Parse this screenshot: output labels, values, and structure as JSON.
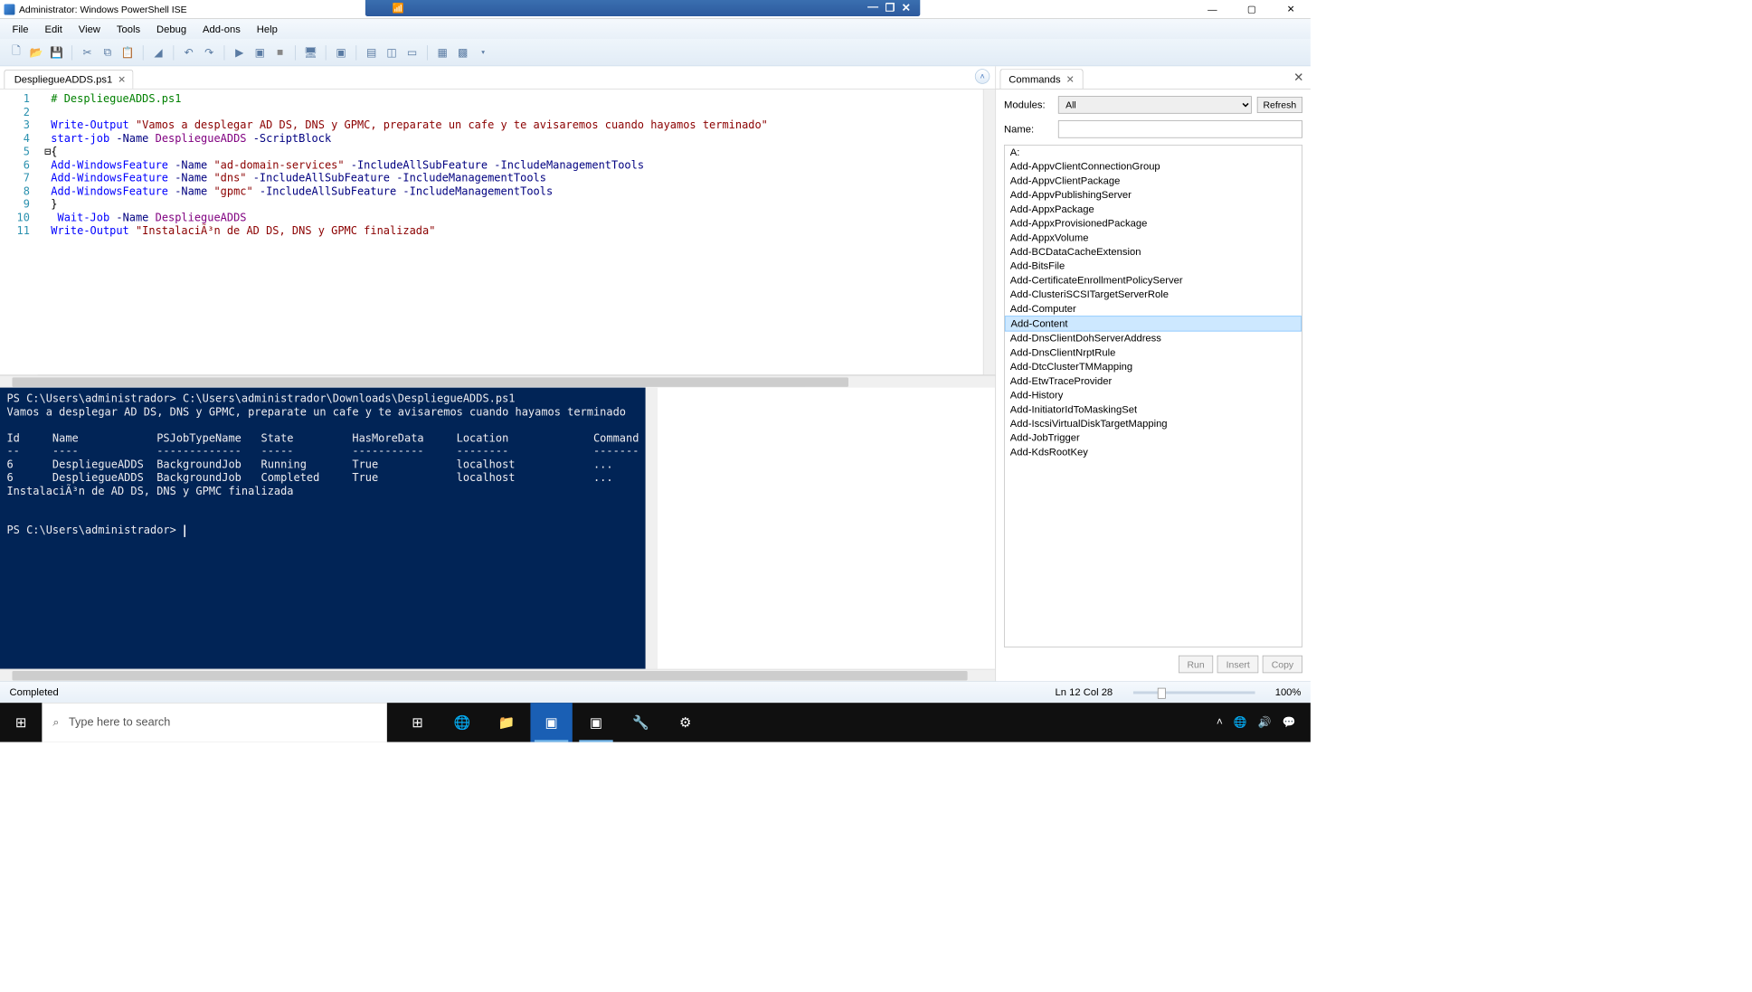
{
  "window": {
    "title": "Administrator: Windows PowerShell ISE"
  },
  "menu": {
    "file": "File",
    "edit": "Edit",
    "view": "View",
    "tools": "Tools",
    "debug": "Debug",
    "addons": "Add-ons",
    "help": "Help"
  },
  "tab": {
    "name": "DespliegueADDS.ps1"
  },
  "code_lines": [
    {
      "n": "1",
      "tokens": [
        [
          "  ",
          ""
        ],
        [
          "# DespliegueADDS.ps1",
          "cm"
        ]
      ]
    },
    {
      "n": "2",
      "tokens": []
    },
    {
      "n": "3",
      "tokens": [
        [
          "  ",
          ""
        ],
        [
          "Write-Output",
          "cmd"
        ],
        [
          " ",
          ""
        ],
        [
          "\"Vamos a desplegar AD DS, DNS y GPMC, preparate un cafe y te avisaremos cuando hayamos terminado\"",
          "str"
        ]
      ]
    },
    {
      "n": "4",
      "tokens": [
        [
          "  ",
          ""
        ],
        [
          "start-job",
          "cmd"
        ],
        [
          " ",
          ""
        ],
        [
          "-Name",
          "par"
        ],
        [
          " ",
          ""
        ],
        [
          "DespliegueADDS",
          "bare"
        ],
        [
          " ",
          ""
        ],
        [
          "-ScriptBlock",
          "par"
        ]
      ]
    },
    {
      "n": "5",
      "tokens": [
        [
          " ⊟{",
          ""
        ]
      ]
    },
    {
      "n": "6",
      "tokens": [
        [
          "  ",
          ""
        ],
        [
          "Add-WindowsFeature",
          "cmd"
        ],
        [
          " ",
          ""
        ],
        [
          "-Name",
          "par"
        ],
        [
          " ",
          ""
        ],
        [
          "\"ad-domain-services\"",
          "str"
        ],
        [
          " ",
          ""
        ],
        [
          "-IncludeAllSubFeature",
          "par"
        ],
        [
          " ",
          ""
        ],
        [
          "-IncludeManagementTools",
          "par"
        ]
      ]
    },
    {
      "n": "7",
      "tokens": [
        [
          "  ",
          ""
        ],
        [
          "Add-WindowsFeature",
          "cmd"
        ],
        [
          " ",
          ""
        ],
        [
          "-Name",
          "par"
        ],
        [
          " ",
          ""
        ],
        [
          "\"dns\"",
          "str"
        ],
        [
          " ",
          ""
        ],
        [
          "-IncludeAllSubFeature",
          "par"
        ],
        [
          " ",
          ""
        ],
        [
          "-IncludeManagementTools",
          "par"
        ]
      ]
    },
    {
      "n": "8",
      "tokens": [
        [
          "  ",
          ""
        ],
        [
          "Add-WindowsFeature",
          "cmd"
        ],
        [
          " ",
          ""
        ],
        [
          "-Name",
          "par"
        ],
        [
          " ",
          ""
        ],
        [
          "\"gpmc\"",
          "str"
        ],
        [
          " ",
          ""
        ],
        [
          "-IncludeAllSubFeature",
          "par"
        ],
        [
          " ",
          ""
        ],
        [
          "-IncludeManagementTools",
          "par"
        ]
      ]
    },
    {
      "n": "9",
      "tokens": [
        [
          "  }",
          ""
        ]
      ]
    },
    {
      "n": "10",
      "tokens": [
        [
          "   ",
          ""
        ],
        [
          "Wait-Job",
          "cmd"
        ],
        [
          " ",
          ""
        ],
        [
          "-Name",
          "par"
        ],
        [
          " ",
          ""
        ],
        [
          "DespliegueADDS",
          "bare"
        ]
      ]
    },
    {
      "n": "11",
      "tokens": [
        [
          "  ",
          ""
        ],
        [
          "Write-Output",
          "cmd"
        ],
        [
          " ",
          ""
        ],
        [
          "\"InstalaciÃ³n de AD DS, DNS y GPMC finalizada\"",
          "str"
        ]
      ]
    }
  ],
  "console_text": "PS C:\\Users\\administrador> C:\\Users\\administrador\\Downloads\\DespliegueADDS.ps1\nVamos a desplegar AD DS, DNS y GPMC, preparate un cafe y te avisaremos cuando hayamos terminado\n\nId     Name            PSJobTypeName   State         HasMoreData     Location             Command\n--     ----            -------------   -----         -----------     --------             -------\n6      DespliegueADDS  BackgroundJob   Running       True            localhost            ...\n6      DespliegueADDS  BackgroundJob   Completed     True            localhost            ...\nInstalaciÃ³n de AD DS, DNS y GPMC finalizada\n\n\nPS C:\\Users\\administrador> ",
  "commands_panel": {
    "title": "Commands",
    "modules_label": "Modules:",
    "modules_value": "All",
    "name_label": "Name:",
    "refresh": "Refresh",
    "list": [
      "A:",
      "Add-AppvClientConnectionGroup",
      "Add-AppvClientPackage",
      "Add-AppvPublishingServer",
      "Add-AppxPackage",
      "Add-AppxProvisionedPackage",
      "Add-AppxVolume",
      "Add-BCDataCacheExtension",
      "Add-BitsFile",
      "Add-CertificateEnrollmentPolicyServer",
      "Add-ClusteriSCSITargetServerRole",
      "Add-Computer",
      "Add-Content",
      "Add-DnsClientDohServerAddress",
      "Add-DnsClientNrptRule",
      "Add-DtcClusterTMMapping",
      "Add-EtwTraceProvider",
      "Add-History",
      "Add-InitiatorIdToMaskingSet",
      "Add-IscsiVirtualDiskTargetMapping",
      "Add-JobTrigger",
      "Add-KdsRootKey"
    ],
    "selected": "Add-Content",
    "run": "Run",
    "insert": "Insert",
    "copy": "Copy"
  },
  "status": {
    "left": "Completed",
    "pos": "Ln 12  Col 28",
    "zoom": "100%"
  },
  "taskbar": {
    "search_placeholder": "Type here to search"
  }
}
